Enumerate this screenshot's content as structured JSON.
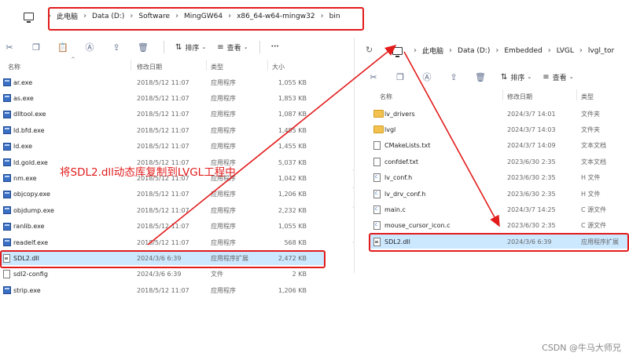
{
  "left_window": {
    "breadcrumb": [
      "此电脑",
      "Data (D:)",
      "Software",
      "MingGW64",
      "x86_64-w64-mingw32",
      "bin"
    ],
    "toolbar": {
      "sort_label": "排序",
      "view_label": "查看",
      "more_label": "···"
    },
    "columns": {
      "name": "名称",
      "date": "修改日期",
      "type": "类型",
      "size": "大小"
    },
    "rows": [
      {
        "name": "ar.exe",
        "date": "2018/5/12 11:07",
        "type": "应用程序",
        "size": "1,055 KB",
        "icon": "exe-icon"
      },
      {
        "name": "as.exe",
        "date": "2018/5/12 11:07",
        "type": "应用程序",
        "size": "1,853 KB",
        "icon": "exe-icon"
      },
      {
        "name": "dlltool.exe",
        "date": "2018/5/12 11:07",
        "type": "应用程序",
        "size": "1,087 KB",
        "icon": "exe-icon"
      },
      {
        "name": "ld.bfd.exe",
        "date": "2018/5/12 11:07",
        "type": "应用程序",
        "size": "1,455 KB",
        "icon": "exe-icon"
      },
      {
        "name": "ld.exe",
        "date": "2018/5/12 11:07",
        "type": "应用程序",
        "size": "1,455 KB",
        "icon": "exe-icon"
      },
      {
        "name": "ld.gold.exe",
        "date": "2018/5/12 11:07",
        "type": "应用程序",
        "size": "5,037 KB",
        "icon": "exe-icon"
      },
      {
        "name": "nm.exe",
        "date": "2018/5/12 11:07",
        "type": "应用程序",
        "size": "1,042 KB",
        "icon": "exe-icon"
      },
      {
        "name": "objcopy.exe",
        "date": "2018/5/12 11:07",
        "type": "应用程序",
        "size": "1,206 KB",
        "icon": "exe-icon"
      },
      {
        "name": "objdump.exe",
        "date": "2018/5/12 11:07",
        "type": "应用程序",
        "size": "2,232 KB",
        "icon": "exe-icon"
      },
      {
        "name": "ranlib.exe",
        "date": "2018/5/12 11:07",
        "type": "应用程序",
        "size": "1,055 KB",
        "icon": "exe-icon"
      },
      {
        "name": "readelf.exe",
        "date": "2018/5/12 11:07",
        "type": "应用程序",
        "size": "568 KB",
        "icon": "exe-icon"
      },
      {
        "name": "SDL2.dll",
        "date": "2024/3/6 6:39",
        "type": "应用程序扩展",
        "size": "2,472 KB",
        "icon": "dll-icon",
        "selected": true
      },
      {
        "name": "sdl2-config",
        "date": "2024/3/6 6:39",
        "type": "文件",
        "size": "2 KB",
        "icon": "file-icon"
      },
      {
        "name": "strip.exe",
        "date": "2018/5/12 11:07",
        "type": "应用程序",
        "size": "1,206 KB",
        "icon": "exe-icon"
      }
    ]
  },
  "right_window": {
    "breadcrumb": [
      "此电脑",
      "Data (D:)",
      "Embedded",
      "LVGL",
      "lvgl_tor"
    ],
    "toolbar": {
      "sort_label": "排序",
      "view_label": "查看"
    },
    "columns": {
      "name": "名称",
      "date": "修改日期",
      "type": "类型"
    },
    "rows": [
      {
        "name": "lv_drivers",
        "date": "2024/3/7 14:01",
        "type": "文件夹",
        "icon": "folder-icon"
      },
      {
        "name": "lvgl",
        "date": "2024/3/7 14:03",
        "type": "文件夹",
        "icon": "folder-icon"
      },
      {
        "name": "CMakeLists.txt",
        "date": "2024/3/7 14:09",
        "type": "文本文档",
        "icon": "text-file-icon"
      },
      {
        "name": "confdef.txt",
        "date": "2023/6/30 2:35",
        "type": "文本文档",
        "icon": "text-file-icon"
      },
      {
        "name": "lv_conf.h",
        "date": "2023/6/30 2:35",
        "type": "H 文件",
        "icon": "h-file-icon"
      },
      {
        "name": "lv_drv_conf.h",
        "date": "2023/6/30 2:35",
        "type": "H 文件",
        "icon": "h-file-icon"
      },
      {
        "name": "main.c",
        "date": "2024/3/7 14:25",
        "type": "C 源文件",
        "icon": "c-file-icon"
      },
      {
        "name": "mouse_cursor_icon.c",
        "date": "2023/6/30 2:35",
        "type": "C 源文件",
        "icon": "c-file-icon"
      },
      {
        "name": "SDL2.dll",
        "date": "2024/3/6 6:39",
        "type": "应用程序扩展",
        "icon": "dll-icon",
        "selected": true
      }
    ]
  },
  "annotation": {
    "text": "将SDL2.dll动态库复制到LVGL工程中",
    "color": "#e21b1b"
  },
  "watermark": "CSDN @牛马大师兄",
  "colors": {
    "selection": "#cce8ff",
    "highlight_box": "#e21b1b"
  }
}
